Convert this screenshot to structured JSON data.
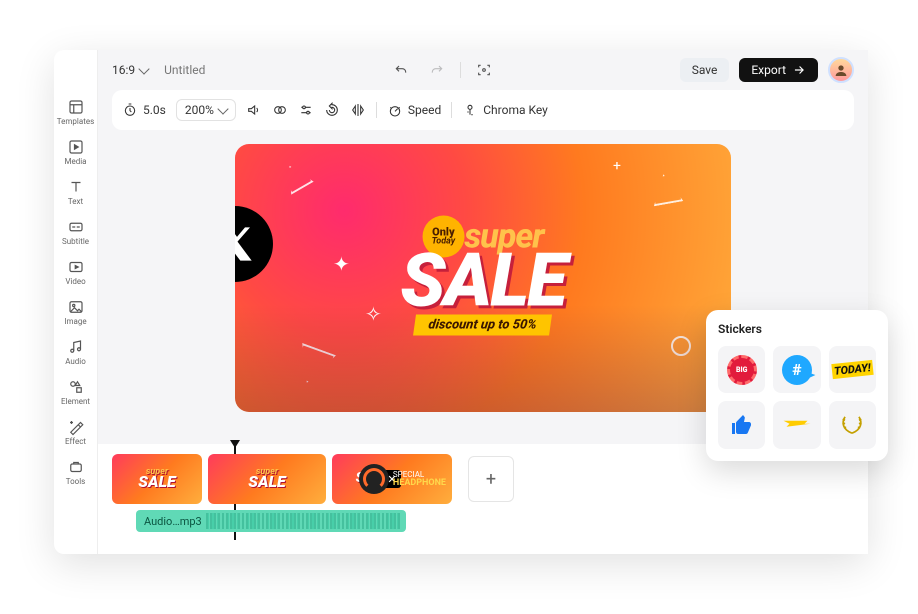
{
  "window": {
    "title": "Untitled",
    "aspect": "16:9"
  },
  "header": {
    "save_label": "Save",
    "export_label": "Export"
  },
  "toolbar": {
    "duration": "5.0s",
    "zoom": "200%",
    "speed_label": "Speed",
    "chroma_label": "Chroma Key"
  },
  "sidebar": {
    "items": [
      {
        "label": "Templates"
      },
      {
        "label": "Media"
      },
      {
        "label": "Text"
      },
      {
        "label": "Subtitle"
      },
      {
        "label": "Video"
      },
      {
        "label": "Image"
      },
      {
        "label": "Audio"
      },
      {
        "label": "Element"
      },
      {
        "label": "Effect"
      },
      {
        "label": "Tools"
      }
    ]
  },
  "canvas": {
    "badge_line1": "Only",
    "badge_line2": "Today",
    "super": "super",
    "sale": "SALE",
    "discount": "discount up to 50%"
  },
  "stickers": {
    "title": "Stickers",
    "items": [
      "big-sale",
      "hashtag",
      "today",
      "thumbs-up",
      "swoosh",
      "laurel"
    ]
  },
  "timeline": {
    "audio_name": "Audio…mp3",
    "clip3_special": "SPECIAL",
    "clip3_headphone": "HEADPHONE"
  }
}
